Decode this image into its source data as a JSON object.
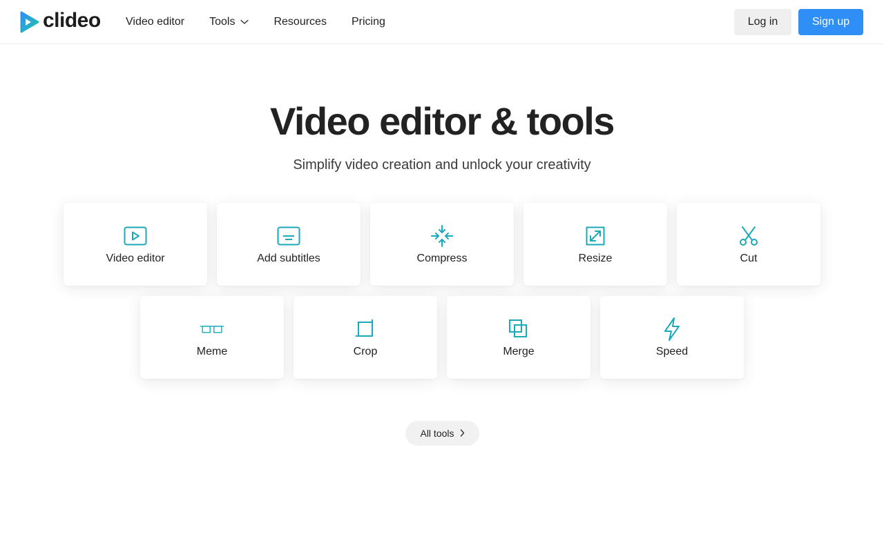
{
  "brand": {
    "name": "clideo",
    "accent": "#2f8ff6",
    "icon_color": "#1aa9b8"
  },
  "nav": {
    "items": [
      {
        "label": "Video editor"
      },
      {
        "label": "Tools",
        "icon": "chevron-down-icon"
      },
      {
        "label": "Resources"
      },
      {
        "label": "Pricing"
      }
    ]
  },
  "auth": {
    "login_label": "Log in",
    "signup_label": "Sign up"
  },
  "hero": {
    "title": "Video editor & tools",
    "subtitle": "Simplify video creation and unlock your creativity"
  },
  "tools": [
    {
      "label": "Video editor",
      "icon": "play-icon"
    },
    {
      "label": "Add subtitles",
      "icon": "subtitles-icon"
    },
    {
      "label": "Compress",
      "icon": "compress-icon"
    },
    {
      "label": "Resize",
      "icon": "resize-icon"
    },
    {
      "label": "Cut",
      "icon": "scissors-icon"
    },
    {
      "label": "Meme",
      "icon": "glasses-icon"
    },
    {
      "label": "Crop",
      "icon": "crop-icon"
    },
    {
      "label": "Merge",
      "icon": "merge-icon"
    },
    {
      "label": "Speed",
      "icon": "lightning-icon"
    }
  ],
  "all_tools": {
    "label": "All tools",
    "icon": "chevron-right-icon"
  }
}
